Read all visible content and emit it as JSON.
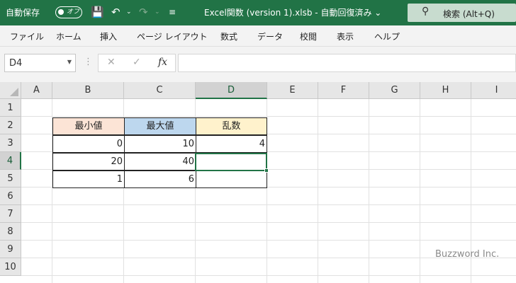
{
  "titlebar": {
    "autosave_label": "自動保存",
    "autosave_state": "オフ",
    "title": "Excel関数 (version 1).xlsb  -  自動回復済み  ⌄",
    "search_label": "検索 (Alt+Q)"
  },
  "menu": [
    "ファイル",
    "ホーム",
    "挿入",
    "ページ レイアウト",
    "数式",
    "データ",
    "校閲",
    "表示",
    "ヘルプ"
  ],
  "formula_bar": {
    "name_box": "D4",
    "fx_label": "fx",
    "formula": ""
  },
  "columns": [
    "A",
    "B",
    "C",
    "D",
    "E",
    "F",
    "G",
    "H",
    "I"
  ],
  "rows": [
    "1",
    "2",
    "3",
    "4",
    "5",
    "6",
    "7",
    "8",
    "9",
    "10"
  ],
  "table": {
    "headers": [
      "最小値",
      "最大値",
      "乱数"
    ],
    "header_colors": [
      "#fce4d6",
      "#bdd7ee",
      "#fff2cc"
    ],
    "rows": [
      [
        "0",
        "10",
        "4"
      ],
      [
        "20",
        "40",
        ""
      ],
      [
        "1",
        "6",
        ""
      ]
    ]
  },
  "active_cell": "D4",
  "accent_color": "#217346",
  "watermark": "Buzzword Inc."
}
